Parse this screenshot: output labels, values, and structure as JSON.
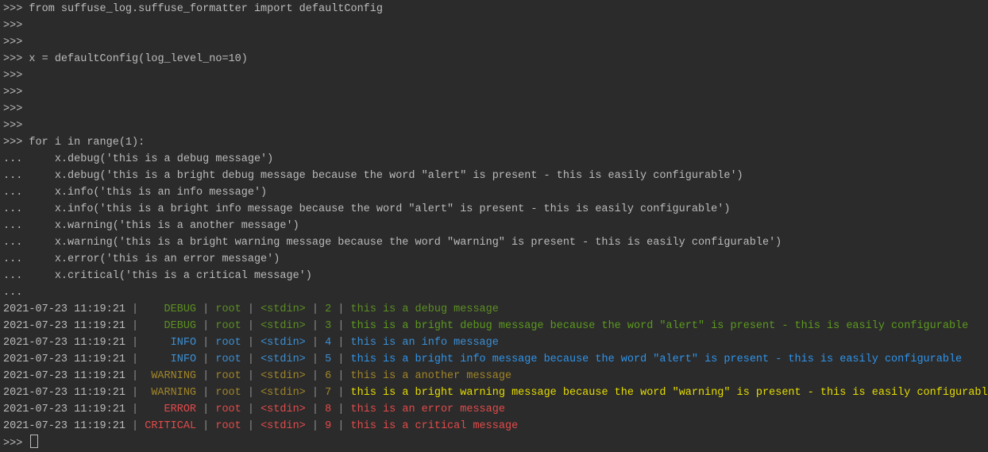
{
  "colors": {
    "background": "#2b2b2b",
    "text": "#bbbbbb",
    "pipe": "#8c8c8c",
    "debug": "#5c8f22",
    "debug_bright": "#5c9a1e",
    "info": "#3b8fd4",
    "info_bright": "#2f93ea",
    "warning": "#a08528",
    "warning_bright": "#e6dd00",
    "error": "#e34a4a",
    "critical": "#e34a4a"
  },
  "code_lines": [
    {
      "prompt": ">>>",
      "code": " from suffuse_log.suffuse_formatter import defaultConfig"
    },
    {
      "prompt": ">>>",
      "code": ""
    },
    {
      "prompt": ">>>",
      "code": ""
    },
    {
      "prompt": ">>>",
      "code": " x = defaultConfig(log_level_no=10)"
    },
    {
      "prompt": ">>>",
      "code": ""
    },
    {
      "prompt": ">>>",
      "code": ""
    },
    {
      "prompt": ">>>",
      "code": ""
    },
    {
      "prompt": ">>>",
      "code": ""
    },
    {
      "prompt": ">>>",
      "code": " for i in range(1):"
    },
    {
      "prompt": "...",
      "code": "     x.debug('this is a debug message')"
    },
    {
      "prompt": "...",
      "code": "     x.debug('this is a bright debug message because the word \"alert\" is present - this is easily configurable')"
    },
    {
      "prompt": "...",
      "code": "     x.info('this is an info message')"
    },
    {
      "prompt": "...",
      "code": "     x.info('this is a bright info message because the word \"alert\" is present - this is easily configurable')"
    },
    {
      "prompt": "...",
      "code": "     x.warning('this is a another message')"
    },
    {
      "prompt": "...",
      "code": "     x.warning('this is a bright warning message because the word \"warning\" is present - this is easily configurable')"
    },
    {
      "prompt": "...",
      "code": "     x.error('this is an error message')"
    },
    {
      "prompt": "...",
      "code": "     x.critical('this is a critical message')"
    },
    {
      "prompt": "...",
      "code": ""
    }
  ],
  "log_rows": [
    {
      "timestamp": "2021-07-23 11:19:21",
      "level": "DEBUG",
      "logger": "root",
      "source": "<stdin>",
      "line": "2",
      "message": "this is a debug message",
      "color": "debug",
      "msg_color": "debug"
    },
    {
      "timestamp": "2021-07-23 11:19:21",
      "level": "DEBUG",
      "logger": "root",
      "source": "<stdin>",
      "line": "3",
      "message": "this is a bright debug message because the word \"alert\" is present - this is easily configurable",
      "color": "debug",
      "msg_color": "debug_bright"
    },
    {
      "timestamp": "2021-07-23 11:19:21",
      "level": "INFO",
      "logger": "root",
      "source": "<stdin>",
      "line": "4",
      "message": "this is an info message",
      "color": "info",
      "msg_color": "info"
    },
    {
      "timestamp": "2021-07-23 11:19:21",
      "level": "INFO",
      "logger": "root",
      "source": "<stdin>",
      "line": "5",
      "message": "this is a bright info message because the word \"alert\" is present - this is easily configurable",
      "color": "info",
      "msg_color": "info_bright"
    },
    {
      "timestamp": "2021-07-23 11:19:21",
      "level": "WARNING",
      "logger": "root",
      "source": "<stdin>",
      "line": "6",
      "message": "this is a another message",
      "color": "warning",
      "msg_color": "warning"
    },
    {
      "timestamp": "2021-07-23 11:19:21",
      "level": "WARNING",
      "logger": "root",
      "source": "<stdin>",
      "line": "7",
      "message": "this is a bright warning message because the word \"warning\" is present - this is easily configurable",
      "color": "warning",
      "msg_color": "warning_bright"
    },
    {
      "timestamp": "2021-07-23 11:19:21",
      "level": "ERROR",
      "logger": "root",
      "source": "<stdin>",
      "line": "8",
      "message": "this is an error message",
      "color": "error",
      "msg_color": "error"
    },
    {
      "timestamp": "2021-07-23 11:19:21",
      "level": "CRITICAL",
      "logger": "root",
      "source": "<stdin>",
      "line": "9",
      "message": "this is a critical message",
      "color": "critical",
      "msg_color": "critical"
    }
  ],
  "final_prompt": ">>>"
}
